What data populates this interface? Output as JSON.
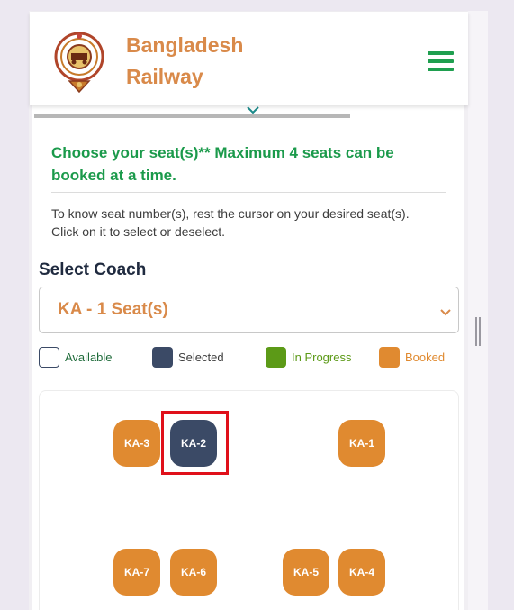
{
  "header": {
    "brand_line1": "Bangladesh",
    "brand_line2": "Railway",
    "menu_icon": "hamburger-icon"
  },
  "instructions": {
    "headline": "Choose your seat(s)** Maximum 4 seats can be booked at a time.",
    "body": "To know seat number(s), rest the cursor on your desired seat(s). Click on it to select or deselect."
  },
  "coach": {
    "label": "Select Coach",
    "selected_value": "KA - 1 Seat(s)"
  },
  "legend": [
    {
      "label": "Available",
      "color": "#ffffff",
      "text_color": "#1f6b3a"
    },
    {
      "label": "Selected",
      "color": "#3b4a66",
      "text_color": "#3d3d3d"
    },
    {
      "label": "In Progress",
      "color": "#5c9a17",
      "text_color": "#5c9a17"
    },
    {
      "label": "Booked",
      "color": "#e08a30",
      "text_color": "#e08a30"
    }
  ],
  "seats": [
    {
      "label": "KA-3",
      "status": "booked"
    },
    {
      "label": "KA-2",
      "status": "selected"
    },
    {
      "label": "KA-1",
      "status": "booked"
    },
    {
      "label": "KA-7",
      "status": "booked"
    },
    {
      "label": "KA-6",
      "status": "booked"
    },
    {
      "label": "KA-5",
      "status": "booked"
    },
    {
      "label": "KA-4",
      "status": "booked"
    }
  ],
  "colors": {
    "brand": "#d98a4a",
    "accent_green": "#1b9a4b",
    "selected": "#3b4a66",
    "booked": "#e08a30",
    "highlight": "#e0101a"
  }
}
